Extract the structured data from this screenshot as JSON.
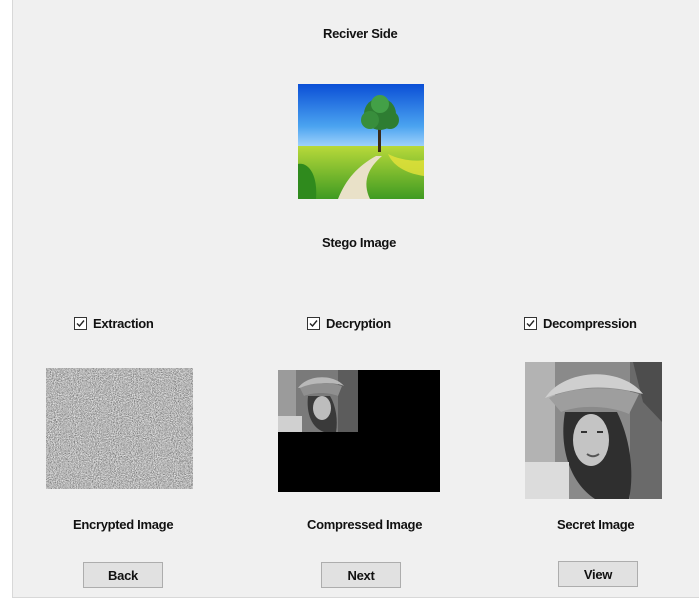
{
  "title": "Reciver Side",
  "stego_caption": "Stego Image",
  "options": [
    {
      "label": "Extraction",
      "checked": true
    },
    {
      "label": "Decryption",
      "checked": true
    },
    {
      "label": "Decompression",
      "checked": true
    }
  ],
  "captions": {
    "encrypted": "Encrypted Image",
    "compressed": "Compressed Image",
    "secret": "Secret Image"
  },
  "buttons": {
    "back": "Back",
    "next": "Next",
    "view": "View"
  }
}
